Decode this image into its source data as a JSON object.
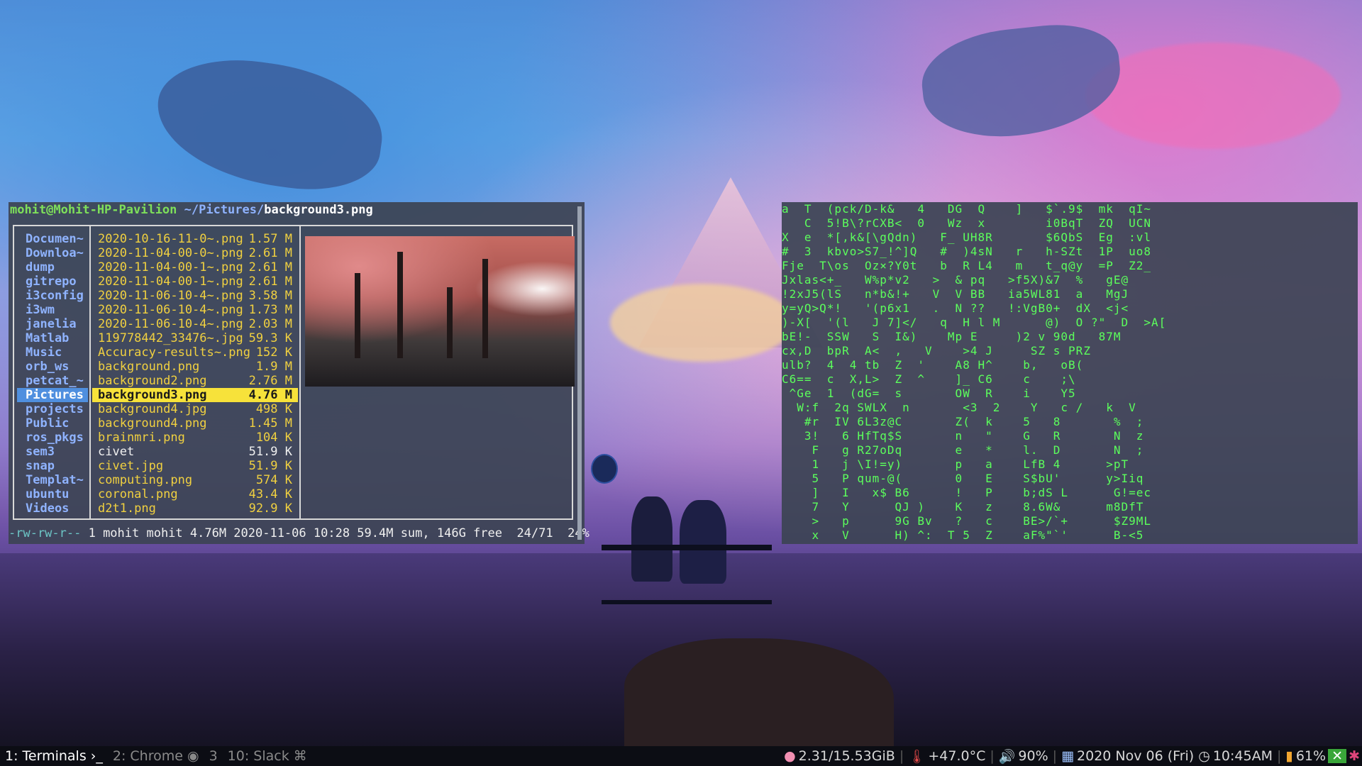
{
  "ranger": {
    "title_user": "mohit@Mohit-HP-Pavilion",
    "title_path": " ~/Pictures/",
    "title_file": "background3.png",
    "parent_dirs": [
      "Documen~",
      "Downloa~",
      "dump",
      "gitrepo",
      "i3config",
      "i3wm",
      "janelia",
      "Matlab",
      "Music",
      "orb_ws",
      "petcat_~",
      "Pictures",
      "projects",
      "Public",
      "ros_pkgs",
      "sem3",
      "snap",
      "Templat~",
      "ubuntu",
      "Videos"
    ],
    "files": [
      {
        "name": "2020-10-16-11-0~.png",
        "size": "1.57 M"
      },
      {
        "name": "2020-11-04-00-0~.png",
        "size": "2.61 M"
      },
      {
        "name": "2020-11-04-00-1~.png",
        "size": "2.61 M"
      },
      {
        "name": "2020-11-04-00-1~.png",
        "size": "2.61 M"
      },
      {
        "name": "2020-11-06-10-4~.png",
        "size": "3.58 M"
      },
      {
        "name": "2020-11-06-10-4~.png",
        "size": "1.73 M"
      },
      {
        "name": "2020-11-06-10-4~.png",
        "size": "2.03 M"
      },
      {
        "name": "119778442_33476~.jpg",
        "size": "59.3 K"
      },
      {
        "name": "Accuracy-results~.png",
        "size": "152 K"
      },
      {
        "name": "background.png",
        "size": "1.9 M"
      },
      {
        "name": "background2.png",
        "size": "2.76 M"
      },
      {
        "name": "background3.png",
        "size": "4.76 M"
      },
      {
        "name": "background4.jpg",
        "size": "498 K"
      },
      {
        "name": "background4.png",
        "size": "1.45 M"
      },
      {
        "name": "brainmri.png",
        "size": "104 K"
      },
      {
        "name": "civet",
        "size": "51.9 K"
      },
      {
        "name": "civet.jpg",
        "size": "51.9 K"
      },
      {
        "name": "computing.png",
        "size": "574 K"
      },
      {
        "name": "coronal.png",
        "size": "43.4 K"
      },
      {
        "name": "d2t1.png",
        "size": "92.9 K"
      }
    ],
    "status_perm": "-rw-rw-r--",
    "status_rest": " 1 mohit mohit 4.76M 2020-11-06 10:28 59.4M sum, 146G free  24/71  24%"
  },
  "matrix_lines": [
    "a  T  (pck/D-k&   4   DG  Q    ]   $`.9$  mk  qI~",
    "   C  5!B\\?rCXB<  0   Wz  x        i0BqT  ZQ  UCN",
    "X  e  *[,k&[\\gQdn)   F_ UH8R       $6QbS  Eg  :vl",
    "#  3  kbvo>S7_!^]Q   #  )4sN   r   h-SZt  1P  uo8",
    "Fje  T\\os  Oz×?Y0t   b  R L4   m   t_q@y  =P  Z2_",
    "Jxlas<+_   W%p*v2   >  & pq   >f5X)&7  %   gE@",
    "!2xJ5(lS   n*b&!+   V  V BB   ia5WL81  a   MgJ",
    "y=yQ>Q*!   '(p6x1   .  N ??   !:VgB0+  dX  <j<",
    ")-X[  '(l   J 7]</   q  H l M      @)  O ?\"  D  >A[",
    "bE!-  SSW   S  I&)    Mp E     )2 v 90d   87M",
    "cx,D  bpR  A<  ,   V    >4 J     SZ s PRZ",
    "ulb?  4  4 tb  Z  '    A8 H^    b,   oB(",
    "C6==  c  X,L>  Z  ^    ]_ C6    c    ;\\",
    " ^Ge  1  (dG=  s       OW  R    i    Y5",
    "  W:f  2q SWLX  n       <3  2    Y   c /   k  V",
    "   #r  IV 6L3z@C       Z(  k    5   8       %  ;",
    "   3!   6 HfTq$S       n   \"    G   R       N  z",
    "    F   g R27oDq       e   *    l.  D       N  ;",
    "    1   j \\I!=y)       p   a    LfB 4      >pT",
    "    5   P qum-@(       0   E    S$bU'      y>Iiq",
    "    ]   I   x$ B6      !   P    b;dS L      G!=ec",
    "    7   Y      QJ )    K   z    8.6W&      m8DfT",
    "    >   p      9G Bv   ?   c    BE>/`+      $Z9ML",
    "    x   V      H) ^:  T 5  Z    aF%\"`'      B-<5"
  ],
  "bar": {
    "workspaces": [
      {
        "label": "1: Terminals ›_",
        "active": true
      },
      {
        "label": "2: Chrome ◉",
        "active": false
      },
      {
        "label": "3",
        "active": false
      },
      {
        "label": "10: Slack ⌘",
        "active": false
      }
    ],
    "memory": "2.31/15.53GiB",
    "temperature": "+47.0°C",
    "volume": "90%",
    "date": "2020 Nov 06 (Fri)",
    "time": "10:45AM",
    "battery": "61%"
  }
}
